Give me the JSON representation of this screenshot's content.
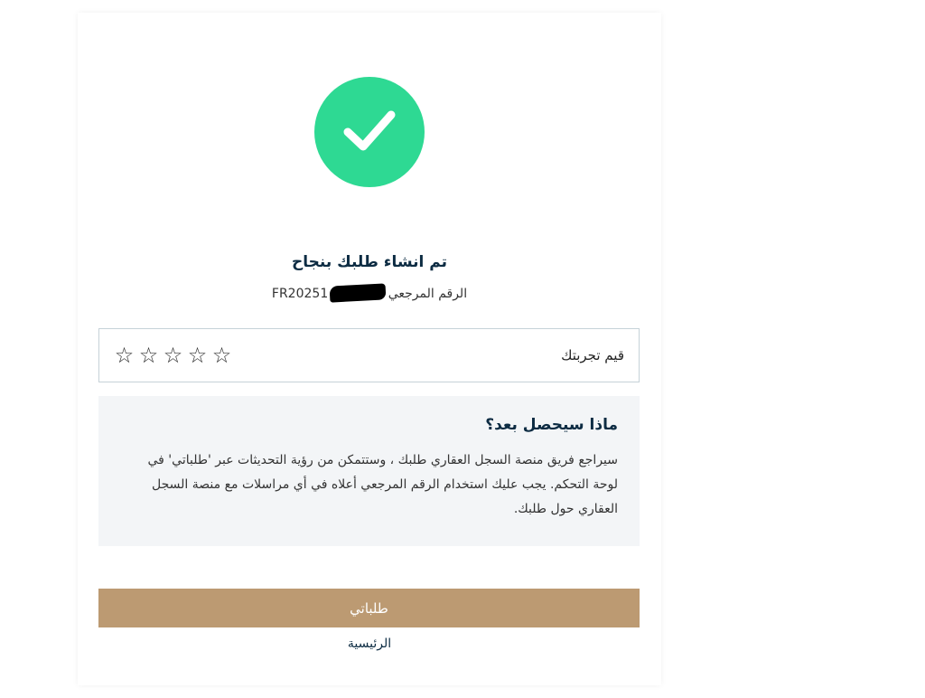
{
  "success": {
    "icon": "check-icon",
    "color": "#2ed993"
  },
  "title": "تم انشاء طلبك بنجاح",
  "reference": {
    "label": "الرقم المرجعي",
    "value": "FR20251"
  },
  "rating": {
    "label": "قيم تجربتك",
    "stars": [
      "☆",
      "☆",
      "☆",
      "☆",
      "☆"
    ]
  },
  "next_steps": {
    "title": "ماذا سيحصل بعد؟",
    "body": "سيراجع فريق منصة السجل العقاري طلبك ، وستتمكن من رؤية التحديثات عبر 'طلباتي' في لوحة التحكم. يجب عليك استخدام الرقم المرجعي أعلاه في أي مراسلات مع منصة السجل العقاري حول طلبك."
  },
  "actions": {
    "primary_label": "طلباتي",
    "home_label": "الرئيسية"
  },
  "colors": {
    "brand_gold": "#bc9a72",
    "navy_text": "#0d2c43",
    "panel_bg": "#f3f5f7"
  }
}
